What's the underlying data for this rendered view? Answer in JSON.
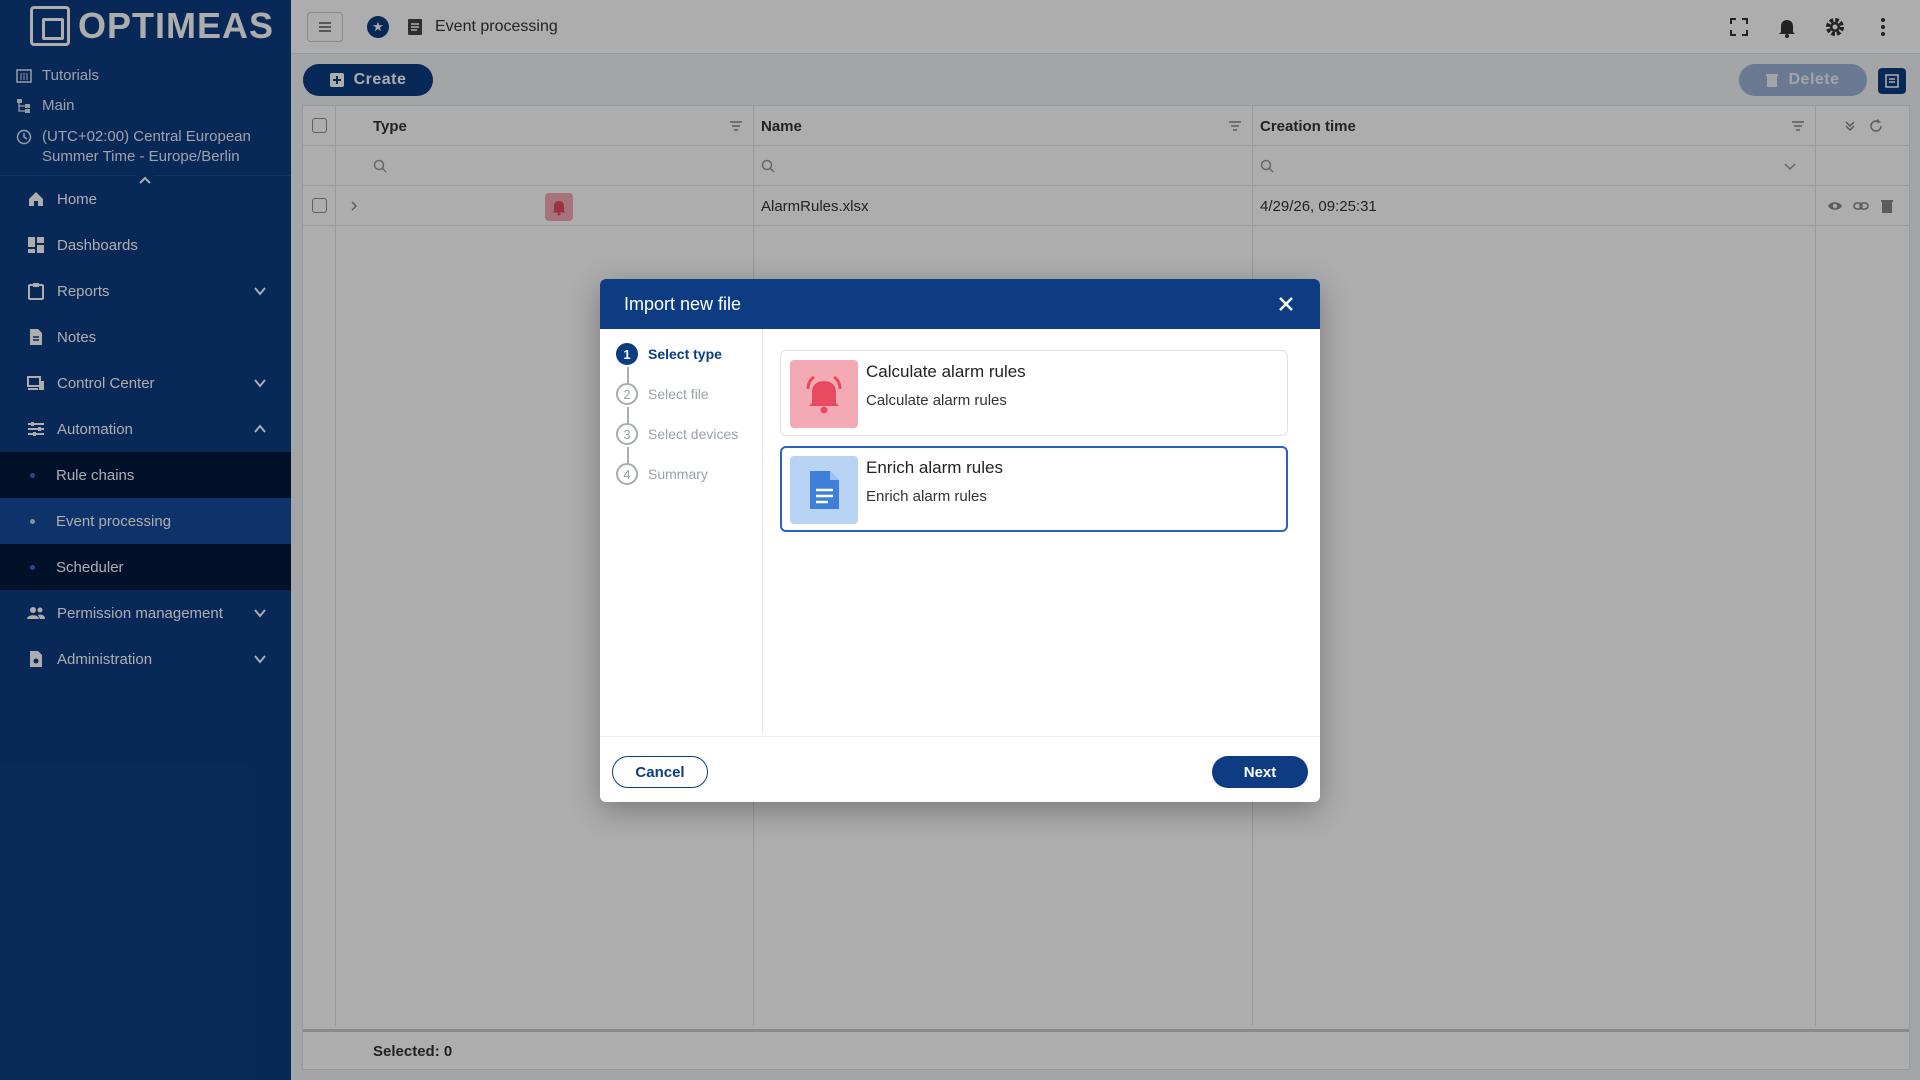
{
  "brand": {
    "logo_text": "OPTIMEAS"
  },
  "sidebar": {
    "meta": {
      "tutorials": "Tutorials",
      "main": "Main",
      "timezone": "(UTC+02:00) Central European Summer Time - Europe/Berlin"
    },
    "items": [
      {
        "label": "Home",
        "icon": "home-icon"
      },
      {
        "label": "Dashboards",
        "icon": "dashboard-icon"
      },
      {
        "label": "Reports",
        "icon": "clipboard-icon",
        "expandable": true
      },
      {
        "label": "Notes",
        "icon": "note-icon"
      },
      {
        "label": "Control Center",
        "icon": "devices-icon",
        "expandable": true
      },
      {
        "label": "Automation",
        "icon": "sliders-icon",
        "expanded": true
      },
      {
        "label": "Permission management",
        "icon": "people-icon",
        "expandable": true
      },
      {
        "label": "Administration",
        "icon": "admin-icon",
        "expandable": true
      }
    ],
    "sub_items": [
      {
        "label": "Rule chains"
      },
      {
        "label": "Event processing",
        "active": true
      },
      {
        "label": "Scheduler"
      }
    ]
  },
  "topbar": {
    "page_title": "Event processing"
  },
  "toolbar": {
    "create_label": "Create",
    "delete_label": "Delete"
  },
  "table": {
    "columns": [
      "Type",
      "Name",
      "Creation time"
    ],
    "rows": [
      {
        "type_icon": "bell-icon",
        "name": "AlarmRules.xlsx",
        "created": "4/29/26, 09:25:31"
      }
    ],
    "footer": "Selected: 0"
  },
  "dialog": {
    "title": "Import new file",
    "steps": [
      {
        "num": "1",
        "label": "Select type",
        "active": true
      },
      {
        "num": "2",
        "label": "Select file"
      },
      {
        "num": "3",
        "label": "Select devices"
      },
      {
        "num": "4",
        "label": "Summary"
      }
    ],
    "options": [
      {
        "title": "Calculate alarm rules",
        "description": "Calculate alarm rules",
        "icon": "bell-icon",
        "color": "#f4aab4",
        "icon_color": "#e84a5f"
      },
      {
        "title": "Enrich alarm rules",
        "description": "Enrich alarm rules",
        "icon": "document-icon",
        "color": "#b9d3f5",
        "icon_color": "#3d7fd9",
        "selected": true
      }
    ],
    "cancel_label": "Cancel",
    "next_label": "Next"
  },
  "colors": {
    "primary": "#0d3c82",
    "accent": "#2a62c2"
  }
}
